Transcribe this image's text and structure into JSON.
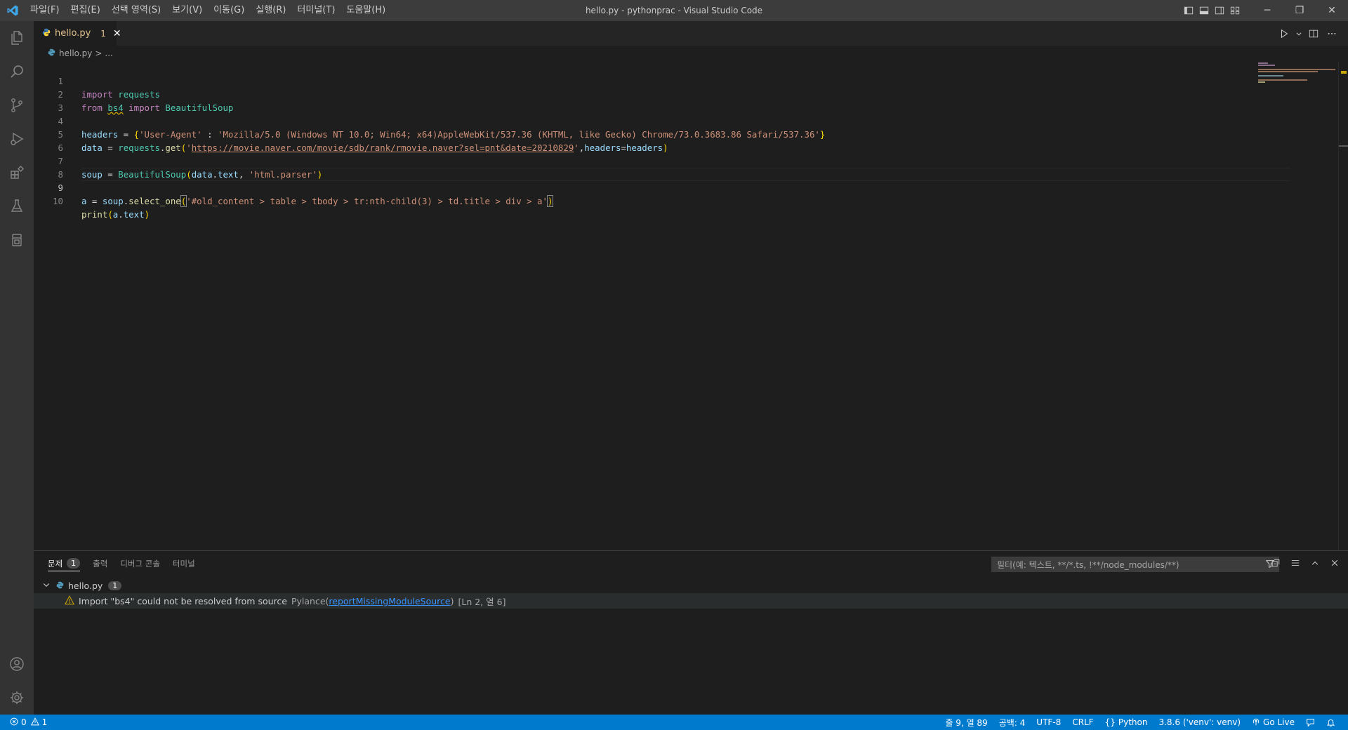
{
  "window": {
    "title": "hello.py - pythonprac - Visual Studio Code",
    "min": "─",
    "restore": "❐",
    "close": "✕"
  },
  "menu": [
    "파일(F)",
    "편집(E)",
    "선택 영역(S)",
    "보기(V)",
    "이동(G)",
    "실행(R)",
    "터미널(T)",
    "도움말(H)"
  ],
  "tab": {
    "label": "hello.py",
    "badge": "1",
    "close": "✕"
  },
  "breadcrumb": {
    "file": "hello.py",
    "sep": ">",
    "rest": "..."
  },
  "editor": {
    "lines": [
      "1",
      "2",
      "3",
      "4",
      "5",
      "6",
      "7",
      "8",
      "9",
      "10"
    ],
    "l1": {
      "kw": "import",
      "mod": "requests"
    },
    "l2": {
      "kw1": "from",
      "mod": "bs4",
      "kw2": "import",
      "cls": "BeautifulSoup"
    },
    "l4": {
      "var": "headers",
      "eq": " = ",
      "open": "{",
      "key": "'User-Agent'",
      "colon": " : ",
      "val": "'Mozilla/5.0 (Windows NT 10.0; Win64; x64)AppleWebKit/537.36 (KHTML, like Gecko) Chrome/73.0.3683.86 Safari/537.36'",
      "close": "}"
    },
    "l5": {
      "var": "data",
      "eq": " = ",
      "obj": "requests",
      "dot": ".",
      "fn": "get",
      "open": "(",
      "q1": "'",
      "url": "https://movie.naver.com/movie/sdb/rank/rmovie.naver?sel=pnt&date=20210829",
      "q2": "'",
      "comma": ",",
      "kwarg": "headers",
      "eq2": "=",
      "arg": "headers",
      "close": ")"
    },
    "l7": {
      "var": "soup",
      "eq": " = ",
      "cls": "BeautifulSoup",
      "open": "(",
      "arg": "data",
      "dot": ".",
      "attr": "text",
      "comma": ", ",
      "str": "'html.parser'",
      "close": ")"
    },
    "l9": {
      "var": "a",
      "eq": " = ",
      "obj": "soup",
      "dot": ".",
      "fn": "select_one",
      "open": "(",
      "str": "'#old_content > table > tbody > tr:nth-child(3) > td.title > div > a'",
      "close": ")"
    },
    "l10": {
      "fn": "print",
      "open": "(",
      "arg": "a",
      "dot": ".",
      "attr": "text",
      "close": ")"
    }
  },
  "panel": {
    "tabs": [
      {
        "label": "문제",
        "count": "1"
      },
      {
        "label": "출력"
      },
      {
        "label": "디버그 콘솔"
      },
      {
        "label": "터미널"
      }
    ],
    "filter_placeholder": "필터(예: 텍스트, **/*.ts, !**/node_modules/**)",
    "problem_file": {
      "name": "hello.py",
      "count": "1"
    },
    "problem": {
      "message": "Import \"bs4\" could not be resolved from source",
      "source": "Pylance",
      "code": "reportMissingModuleSource",
      "location": "[Ln 2, 열 6]"
    }
  },
  "status": {
    "errors": "0",
    "warnings": "1",
    "position": "줄 9, 열 89",
    "spaces": "공백: 4",
    "encoding": "UTF-8",
    "eol": "CRLF",
    "language": "Python",
    "interpreter": "3.8.6 ('venv': venv)",
    "golive": "Go Live"
  },
  "colors": {
    "statusbar": "#007acc",
    "titlebar": "#3c3c3c",
    "activitybar": "#333333",
    "editor_bg": "#1e1e1e",
    "warning": "#cca700"
  }
}
